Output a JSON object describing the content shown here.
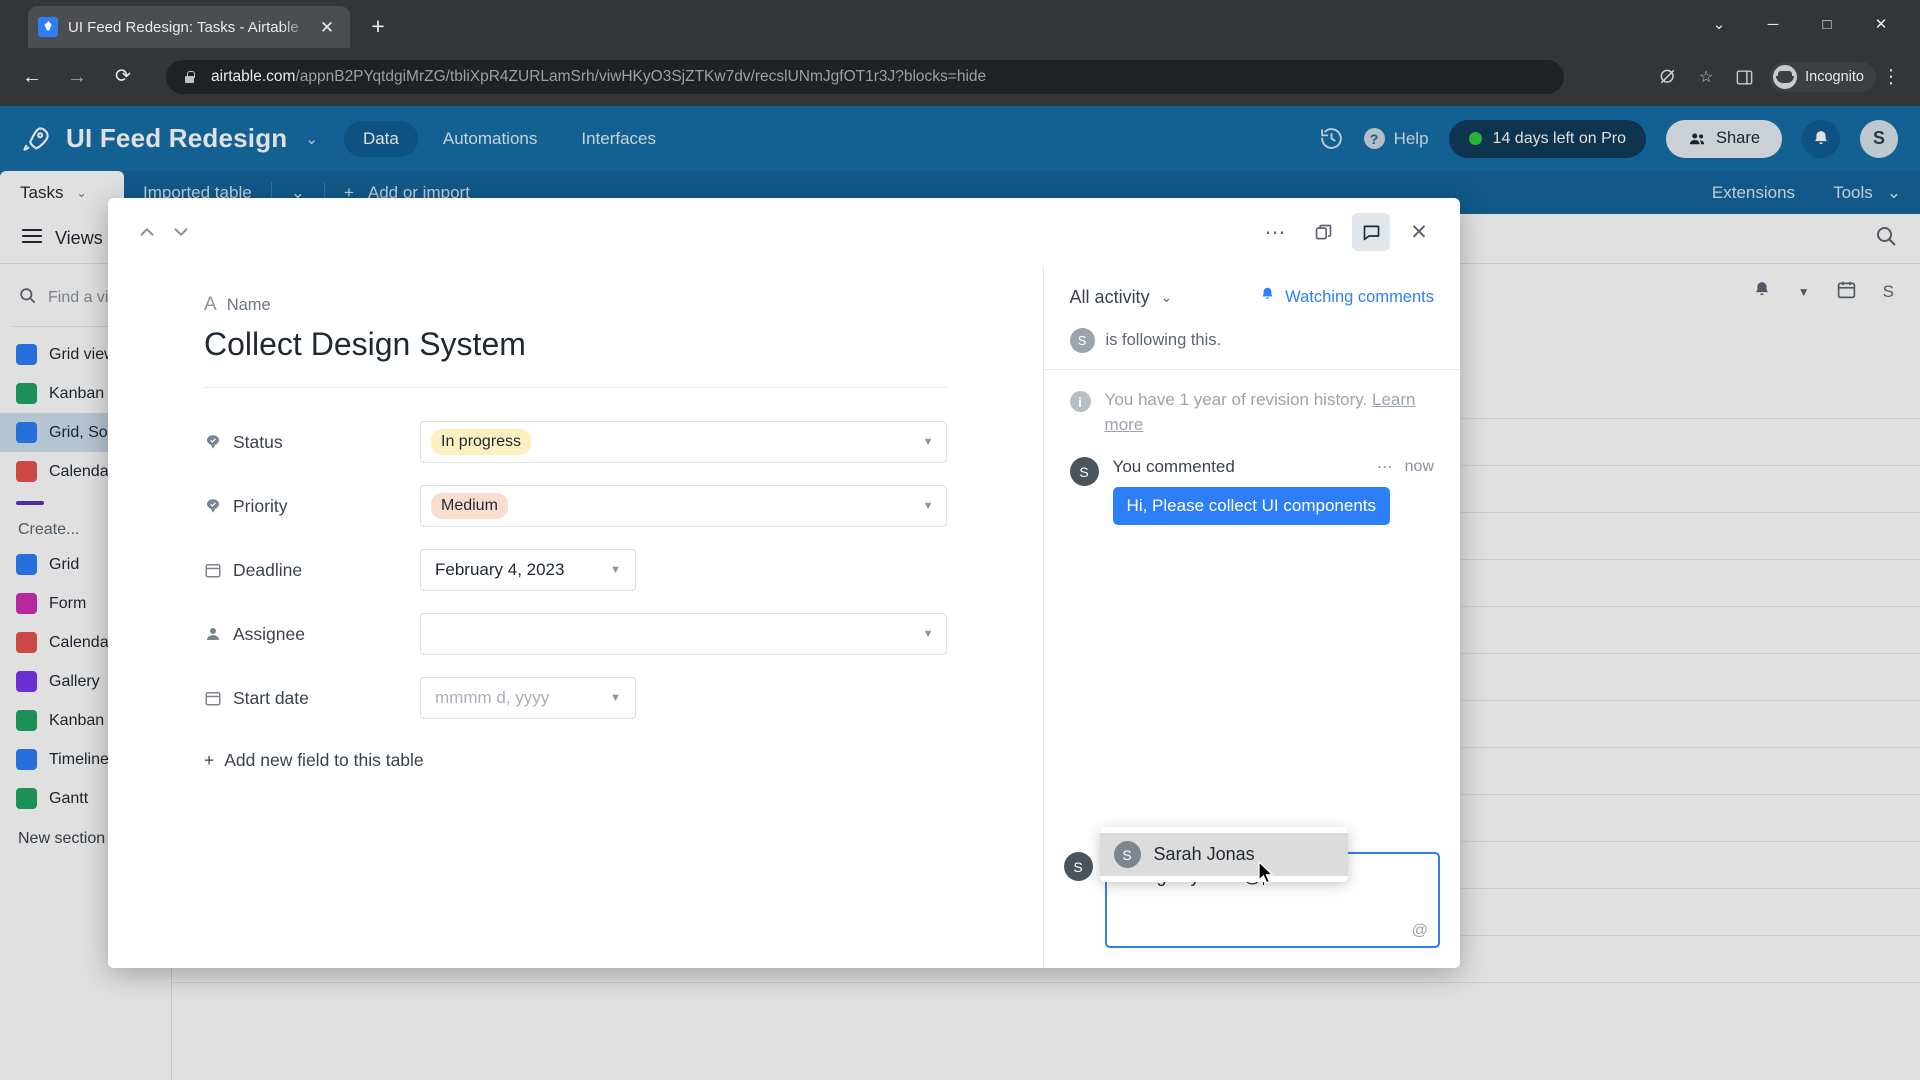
{
  "browser": {
    "tab": {
      "title": "UI Feed Redesign: Tasks - Airtable",
      "favicon": "airtable-icon",
      "close": "✕"
    },
    "new_tab": "+",
    "window_controls": {
      "minimize_menu": "⌄",
      "minimize": "─",
      "maximize": "□",
      "close": "✕"
    },
    "nav": {
      "back": "←",
      "forward": "→",
      "reload": "⟳"
    },
    "url": {
      "domain": "airtable.com",
      "path": "/appnB2PYqtdgiMrZG/tbliXpR4ZURLamSrh/viwHKyO3SjZTKw7dv/recslUNmJgfOT1r3J?blocks=hide"
    },
    "toolbar_right": {
      "third_party_cookies": "⛨",
      "bookmark": "☆",
      "side_panel": "◫",
      "incognito_label": "Incognito",
      "menu": "⋮"
    }
  },
  "app_header": {
    "base_name": "UI Feed Redesign",
    "base_caret": "⌄",
    "nav": [
      {
        "label": "Data",
        "active": true
      },
      {
        "label": "Automations",
        "active": false
      },
      {
        "label": "Interfaces",
        "active": false
      }
    ],
    "history_icon": "history-icon",
    "help_label": "Help",
    "help_glyph": "?",
    "trial_label": "14 days left on Pro",
    "share_label": "Share",
    "bell_icon": "bell-icon",
    "avatar_initial": "S"
  },
  "table_bar": {
    "active_tab": "Tasks",
    "active_caret": "⌄",
    "second_table": "Imported table",
    "second_caret": "⌄",
    "add_or_import": "Add or import",
    "add_plus": "+",
    "extensions": "Extensions",
    "tools": "Tools",
    "tools_caret": "⌄"
  },
  "view_toolbar": {
    "views_label": "Views",
    "search_icon": "search-icon"
  },
  "sidebar": {
    "find_placeholder": "Find a view",
    "views": [
      {
        "label": "Grid view",
        "icon": "grid-icon",
        "color": "#2d7ff9",
        "active": false
      },
      {
        "label": "Kanban",
        "icon": "kanban-icon",
        "color": "#20a463",
        "active": false
      },
      {
        "label": "Grid, Sorted",
        "icon": "grid-icon",
        "color": "#2d7ff9",
        "active": true
      },
      {
        "label": "Calendar",
        "icon": "calendar-icon",
        "color": "#e8554f",
        "active": false
      }
    ],
    "create_label": "Create...",
    "create_items": [
      {
        "label": "Grid",
        "icon": "grid-icon",
        "color": "#2d7ff9"
      },
      {
        "label": "Form",
        "icon": "form-icon",
        "color": "#cf2fb4"
      },
      {
        "label": "Calendar",
        "icon": "calendar-icon",
        "color": "#e8554f"
      },
      {
        "label": "Gallery",
        "icon": "gallery-icon",
        "color": "#7c37ef"
      },
      {
        "label": "Kanban",
        "icon": "kanban-icon",
        "color": "#20a463"
      },
      {
        "label": "Timeline",
        "icon": "timeline-icon",
        "color": "#2d7ff9"
      },
      {
        "label": "Gantt",
        "icon": "gantt-icon",
        "color": "#20a463"
      }
    ],
    "new_section": "New section"
  },
  "record": {
    "prev_icon": "chevron-up-icon",
    "next_icon": "chevron-down-icon",
    "more_icon": "⋯",
    "copy_icon": "duplicate-icon",
    "comment_icon": "comment-icon",
    "close_icon": "✕",
    "primary_field_label": "Name",
    "primary_field_type_icon": "A",
    "primary_value": "Collect Design System",
    "fields": [
      {
        "label": "Status",
        "icon": "single-select-icon",
        "type": "chip",
        "value": "In progress",
        "chip_class": "status",
        "control": "wide"
      },
      {
        "label": "Priority",
        "icon": "single-select-icon",
        "type": "chip",
        "value": "Medium",
        "chip_class": "priority",
        "control": "wide"
      },
      {
        "label": "Deadline",
        "icon": "calendar-icon",
        "type": "date",
        "value": "February 4, 2023",
        "placeholder": false,
        "control": "date"
      },
      {
        "label": "Assignee",
        "icon": "user-icon",
        "type": "empty",
        "value": "",
        "control": "wide"
      },
      {
        "label": "Start date",
        "icon": "calendar-icon",
        "type": "date",
        "value": "mmmm d, yyyy",
        "placeholder": true,
        "control": "date"
      }
    ],
    "add_field_label": "Add new field to this table",
    "add_field_plus": "+"
  },
  "activity": {
    "filter_label": "All activity",
    "filter_caret": "⌄",
    "watching_label": "Watching comments",
    "watching_icon": "bell-icon",
    "following_avatar": "S",
    "following_text": "is following this.",
    "history_note": "You have 1 year of revision history.",
    "history_link": "Learn more",
    "comment": {
      "avatar": "S",
      "author": "You commented",
      "dots": "⋯",
      "time": "now",
      "text": "Hi, Please collect UI components"
    }
  },
  "composer": {
    "avatar": "S",
    "text": "Design system @",
    "at_button": "@",
    "mention_options": [
      {
        "name": "Sarah Jonas",
        "avatar": "S",
        "highlighted": true
      }
    ]
  }
}
